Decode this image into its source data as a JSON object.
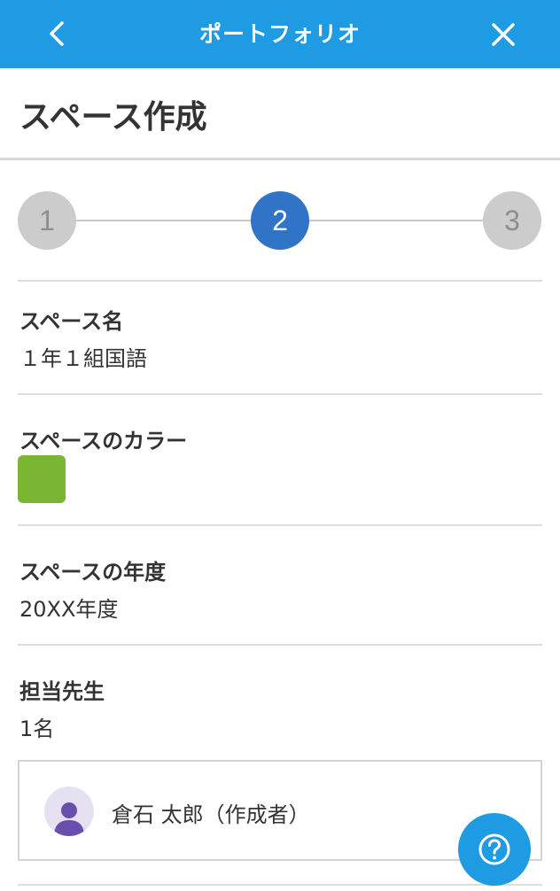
{
  "header": {
    "title": "ポートフォリオ",
    "back_icon": "chevron-left-icon",
    "close_icon": "close-icon",
    "background_color": "#1f9be4"
  },
  "page": {
    "title": "スペース作成"
  },
  "stepper": {
    "steps": [
      "1",
      "2",
      "3"
    ],
    "current_step": 2,
    "active_color": "#2f74c6",
    "inactive_color": "#cccccc"
  },
  "fields": {
    "space_name": {
      "label": "スペース名",
      "value": "１年１組国語"
    },
    "space_color": {
      "label": "スペースのカラー",
      "color": "#7ab534"
    },
    "space_year": {
      "label": "スペースの年度",
      "value": "20XX年度"
    },
    "teachers": {
      "label": "担当先生",
      "count": "1名",
      "list": [
        {
          "name": "倉石 太郎（作成者）",
          "avatar_icon": "person-icon"
        }
      ]
    }
  },
  "help_button": {
    "icon": "help-circle-icon"
  }
}
